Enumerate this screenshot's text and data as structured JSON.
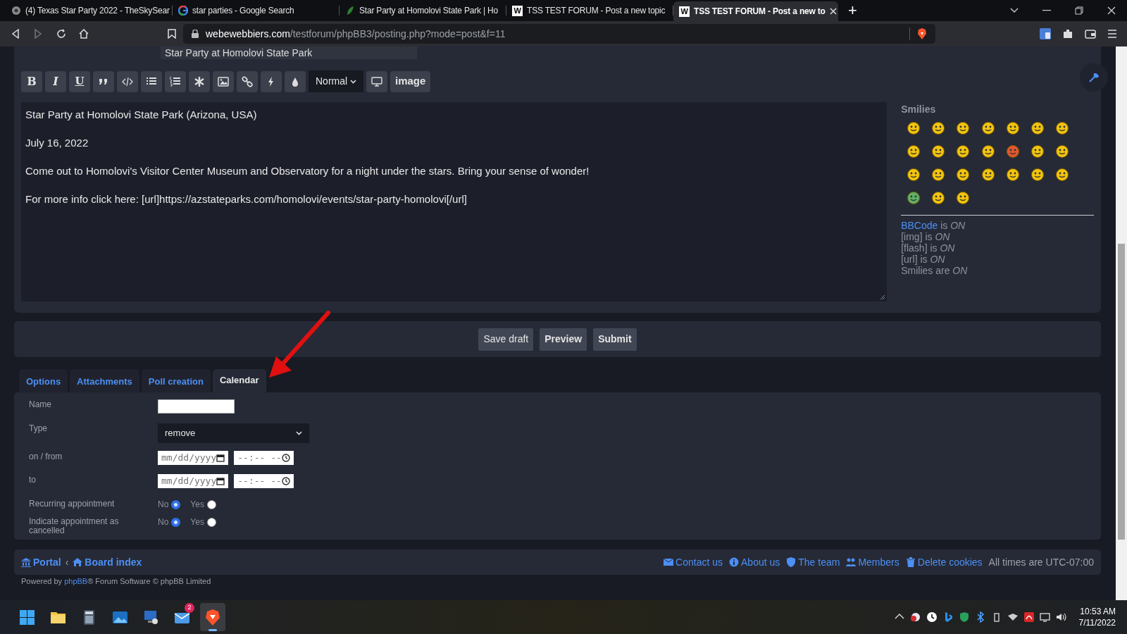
{
  "browser": {
    "tabs": [
      {
        "title": "(4) Texas Star Party 2022 - TheSkySear",
        "selected": false
      },
      {
        "title": "star parties - Google Search",
        "selected": false
      },
      {
        "title": "Star Party at Homolovi State Park | Ho",
        "selected": false
      },
      {
        "title": "TSS TEST FORUM - Post a new topic",
        "icon_text": "W",
        "selected": false
      },
      {
        "title": "TSS TEST FORUM - Post a new to",
        "icon_text": "W",
        "selected": true
      }
    ],
    "new_tab": "+",
    "url_host": "webewebbiers.com",
    "url_path": "/testforum/phpBB3/posting.php?mode=post&f=11"
  },
  "subject": "Star Party at Homolovi State Park",
  "toolbar": [
    {
      "kind": "text",
      "label": "B"
    },
    {
      "kind": "text",
      "label": "I"
    },
    {
      "kind": "text",
      "label": "U"
    },
    {
      "kind": "icon"
    },
    {
      "kind": "icon"
    },
    {
      "kind": "icon"
    },
    {
      "kind": "icon"
    },
    {
      "kind": "icon"
    },
    {
      "kind": "icon"
    },
    {
      "kind": "icon"
    },
    {
      "kind": "icon"
    },
    {
      "kind": "icon"
    },
    {
      "kind": "select",
      "label": "Normal"
    },
    {
      "kind": "icon"
    },
    {
      "kind": "text",
      "label": "image"
    }
  ],
  "message": [
    "Star Party at Homolovi State Park (Arizona, USA)",
    "July 16, 2022",
    "Come out to Homolovi's Visitor Center Museum and Observatory for a night under the stars. Bring your sense of wonder!",
    "For more info click here: [url]https://azstateparks.com/homolovi/events/star-party-homolovi[/url]"
  ],
  "smilies": {
    "title": "Smilies",
    "items": [
      {
        "color": "#f2c40f"
      },
      {
        "color": "#f2c40f"
      },
      {
        "color": "#f2c40f"
      },
      {
        "color": "#f2c40f"
      },
      {
        "color": "#f2c40f"
      },
      {
        "color": "#f2c40f"
      },
      {
        "color": "#f2c40f"
      },
      {
        "color": "#f2c40f"
      },
      {
        "color": "#f2c40f"
      },
      {
        "color": "#f2c40f"
      },
      {
        "color": "#f2c40f"
      },
      {
        "color": "#e4572e"
      },
      {
        "color": "#f2c40f"
      },
      {
        "color": "#f2c40f"
      },
      {
        "color": "#f2c40f"
      },
      {
        "color": "#f2c40f"
      },
      {
        "color": "#f2c40f"
      },
      {
        "color": "#f2c40f"
      },
      {
        "color": "#f2c40f"
      },
      {
        "color": "#f2c40f"
      },
      {
        "color": "#f2c40f"
      },
      {
        "color": "#5fb26a"
      },
      {
        "color": "#f2c40f"
      },
      {
        "color": "#f2c40f"
      }
    ]
  },
  "status": [
    {
      "link": "BBCode",
      "text": " is *ON*"
    },
    {
      "text": "[img] is *ON*"
    },
    {
      "text": "[flash] is *ON*"
    },
    {
      "text": "[url] is *ON*"
    },
    {
      "text": "Smilies are *ON*"
    }
  ],
  "buttons": [
    {
      "label": "Save draft",
      "primary": false
    },
    {
      "label": "Preview",
      "primary": true
    },
    {
      "label": "Submit",
      "primary": true
    }
  ],
  "tabs": [
    {
      "label": "Options",
      "selected": false
    },
    {
      "label": "Attachments",
      "selected": false
    },
    {
      "label": "Poll creation",
      "selected": false
    },
    {
      "label": "Calendar",
      "selected": true
    }
  ],
  "calendar": [
    {
      "kind": "text",
      "label": "Name"
    },
    {
      "kind": "select",
      "label": "Type",
      "value": "remove"
    },
    {
      "kind": "datetime",
      "label": "on / from",
      "date_placeholder": "mm/dd/yyyy",
      "time_placeholder": "--:-- --"
    },
    {
      "kind": "datetime",
      "label": "to",
      "date_placeholder": "mm/dd/yyyy",
      "time_placeholder": "--:-- --"
    },
    {
      "kind": "radio",
      "label": "Recurring appointment",
      "options": [
        {
          "label": "No",
          "selected": true
        },
        {
          "label": "Yes",
          "selected": false
        }
      ]
    },
    {
      "kind": "radio",
      "label": "Indicate appointment as cancelled",
      "options": [
        {
          "label": "No",
          "selected": true
        },
        {
          "label": "Yes",
          "selected": false
        }
      ]
    }
  ],
  "footer": {
    "breadcrumbs": [
      {
        "label": "Portal"
      },
      {
        "label": "Board index"
      }
    ],
    "separator": "‹",
    "links": [
      {
        "label": "Contact us"
      },
      {
        "label": "About us"
      },
      {
        "label": "The team"
      },
      {
        "label": "Members"
      },
      {
        "label": "Delete cookies"
      }
    ],
    "timezone": "All times are UTC-07:00"
  },
  "powered_by": {
    "before": "Powered by ",
    "link": "phpBB",
    "after": "® Forum Software © phpBB Limited"
  },
  "taskbar": {
    "mail_badge": "2",
    "time": "10:53 AM",
    "date": "7/11/2022"
  }
}
